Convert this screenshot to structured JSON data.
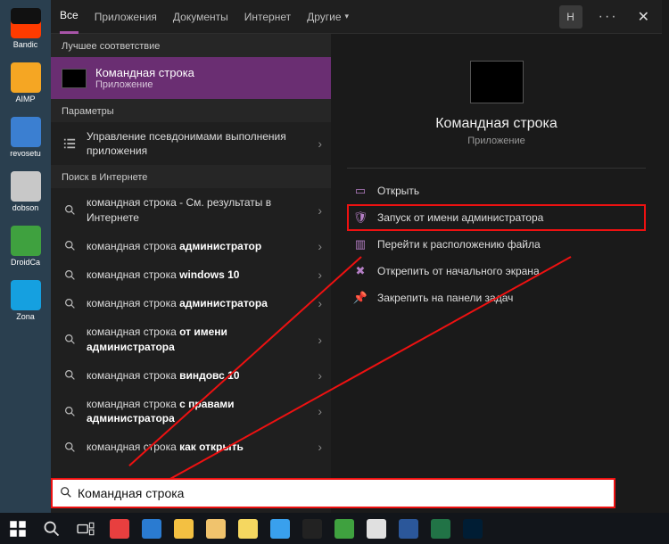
{
  "tabs": {
    "all": "Все",
    "apps": "Приложения",
    "docs": "Документы",
    "web": "Интернет",
    "more": "Другие",
    "user_initial": "Н"
  },
  "sections": {
    "best": "Лучшее соответствие",
    "params": "Параметры",
    "web": "Поиск в Интернете"
  },
  "bestmatch": {
    "title": "Командная строка",
    "subtitle": "Приложение"
  },
  "params_item": {
    "text": "Управление псевдонимами выполнения приложения"
  },
  "web_items": [
    {
      "prefix": "командная строка",
      "suffix": " - См. результаты в Интернете",
      "bold": ""
    },
    {
      "prefix": "командная строка ",
      "bold": "администратор",
      "suffix": ""
    },
    {
      "prefix": "командная строка ",
      "bold": "windows 10",
      "suffix": ""
    },
    {
      "prefix": "командная строка ",
      "bold": "администратора",
      "suffix": ""
    },
    {
      "prefix": "командная строка ",
      "bold": "от имени администратора",
      "suffix": ""
    },
    {
      "prefix": "командная строка ",
      "bold": "виндовс 10",
      "suffix": ""
    },
    {
      "prefix": "командная строка ",
      "bold": "с правами администратора",
      "suffix": ""
    },
    {
      "prefix": "командная строка ",
      "bold": "как открыть",
      "suffix": ""
    }
  ],
  "preview": {
    "title": "Командная строка",
    "subtitle": "Приложение"
  },
  "actions": {
    "open": "Открыть",
    "run_admin": "Запуск от имени администратора",
    "open_location": "Перейти к расположению файла",
    "unpin_start": "Открепить от начального экрана",
    "pin_taskbar": "Закрепить на панели задач"
  },
  "search": {
    "value": "Командная строка"
  },
  "desktop": {
    "items": [
      {
        "label": "Bandic",
        "color": "#111",
        "accent": "#ff3b00"
      },
      {
        "label": "AIMP",
        "color": "#f5a623"
      },
      {
        "label": "revosetu",
        "color": "#3b7fd1"
      },
      {
        "label": "dobson",
        "color": "#c8c8c8"
      },
      {
        "label": "DroidCa",
        "color": "#3fa13f"
      },
      {
        "label": "Zona",
        "color": "#15a0e0"
      }
    ]
  },
  "taskbar": {
    "apps": [
      {
        "name": "opera",
        "color": "#e83f3f"
      },
      {
        "name": "edge",
        "color": "#2a7bd1"
      },
      {
        "name": "chrome",
        "color": "#f3c042"
      },
      {
        "name": "folder",
        "color": "#f0c36d"
      },
      {
        "name": "notes",
        "color": "#f5d760"
      },
      {
        "name": "downloads",
        "color": "#39a0ed"
      },
      {
        "name": "bandicam",
        "color": "#222"
      },
      {
        "name": "utorrent",
        "color": "#3fa13f"
      },
      {
        "name": "paint",
        "color": "#e0e0e0"
      },
      {
        "name": "word",
        "color": "#2b579a"
      },
      {
        "name": "excel",
        "color": "#217346"
      },
      {
        "name": "photoshop",
        "color": "#001d34"
      }
    ]
  }
}
